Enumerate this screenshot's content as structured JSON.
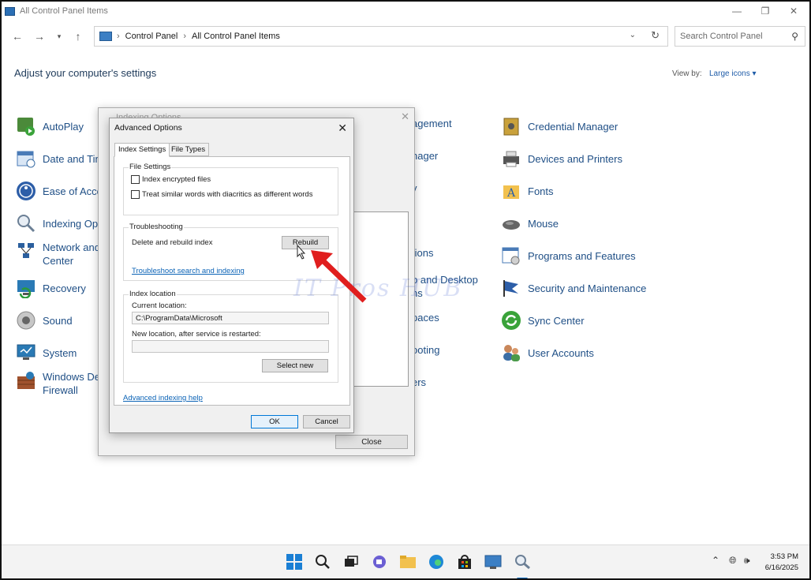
{
  "window": {
    "title": "All Control Panel Items"
  },
  "address": {
    "crumbs": [
      "Control Panel",
      "All Control Panel Items"
    ],
    "search_placeholder": "Search Control Panel"
  },
  "main": {
    "heading": "Adjust your computer's settings",
    "viewby_label": "View by:",
    "viewby_value": "Large icons"
  },
  "items": {
    "col1": [
      "AutoPlay",
      "Date and Tim",
      "Ease of Acce",
      "Indexing Op",
      "Network and",
      "Center",
      "Recovery",
      "Sound",
      "System",
      "Windows De",
      "Firewall"
    ],
    "col2": [
      "agement",
      "nager",
      "y",
      "tions",
      "p and Desktop",
      "ns",
      "paces",
      "ooting",
      "ers"
    ],
    "col3": [
      "Credential Manager",
      "Devices and Printers",
      "Fonts",
      "Mouse",
      "Programs and Features",
      "Security and Maintenance",
      "Sync Center",
      "User Accounts"
    ]
  },
  "indexing_window": {
    "title": "Indexing Options",
    "close_label": "Close"
  },
  "advanced": {
    "title": "Advanced Options",
    "tabs": [
      "Index Settings",
      "File Types"
    ],
    "file_settings": {
      "title": "File Settings",
      "encrypted": "Index encrypted files",
      "diacritics": "Treat similar words with diacritics as different words"
    },
    "troubleshooting": {
      "title": "Troubleshooting",
      "rebuild_text": "Delete and rebuild index",
      "rebuild_button": "Rebuild",
      "troubleshoot_link": "Troubleshoot search and indexing"
    },
    "index_location": {
      "title": "Index location",
      "current_label": "Current location:",
      "current_value": "C:\\ProgramData\\Microsoft",
      "new_label": "New location, after service is restarted:",
      "select_button": "Select new"
    },
    "help_link": "Advanced indexing help",
    "ok": "OK",
    "cancel": "Cancel"
  },
  "watermark": "IT Pros HUB",
  "taskbar": {
    "time": "3:53 PM",
    "date": "6/16/2025"
  },
  "colors": {
    "link": "#1f4f86",
    "accent": "#0078d7",
    "arrow": "#e01e1e"
  }
}
